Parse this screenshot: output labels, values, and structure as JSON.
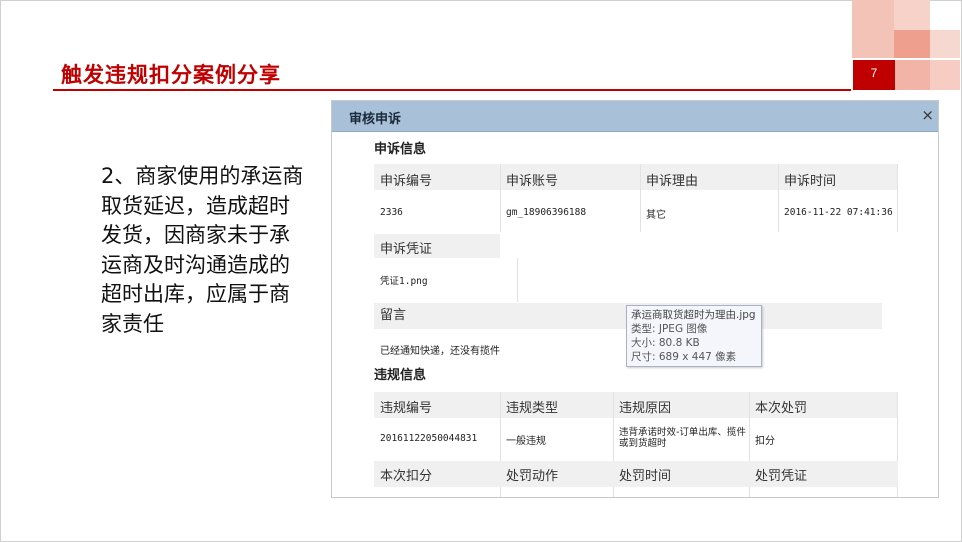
{
  "slide": {
    "title": "触发违规扣分案例分享",
    "page_number": "7",
    "body_text": "2、商家使用的承运商取货延迟，造成超时发货，因商家未于承运商及时沟通造成的超时出库，应属于商家责任"
  },
  "panel": {
    "title": "审核申诉",
    "close_label": "×",
    "appeal_section": "申诉信息",
    "appeal_headers": [
      "申诉编号",
      "申诉账号",
      "申诉理由",
      "申诉时间"
    ],
    "appeal_values": [
      "2336",
      "gm_18906396188",
      "其它",
      "2016-11-22 07:41:36"
    ],
    "evidence_label": "申诉凭证",
    "evidence_file": "凭证1.png",
    "message_label": "留言",
    "message_text": "已经通知快递，还没有揽件",
    "violation_section": "违规信息",
    "violation_headers": [
      "违规编号",
      "违规类型",
      "违规原因",
      "本次处罚"
    ],
    "violation_values": [
      "20161122050044831",
      "一般违规",
      "违背承诺时效-订单出库、揽件或到货超时",
      "扣分"
    ],
    "violation_headers2": [
      "本次扣分",
      "处罚动作",
      "处罚时间",
      "处罚凭证"
    ]
  },
  "tooltip": {
    "filename": "承运商取货超时为理由.jpg",
    "type": "类型: JPEG 图像",
    "size": "大小: 80.8 KB",
    "dimensions": "尺寸: 689 x 447 像素"
  },
  "colors": {
    "accent": "#c00000",
    "panel_header": "#a8c0d8",
    "table_header": "#f0f0f0"
  }
}
